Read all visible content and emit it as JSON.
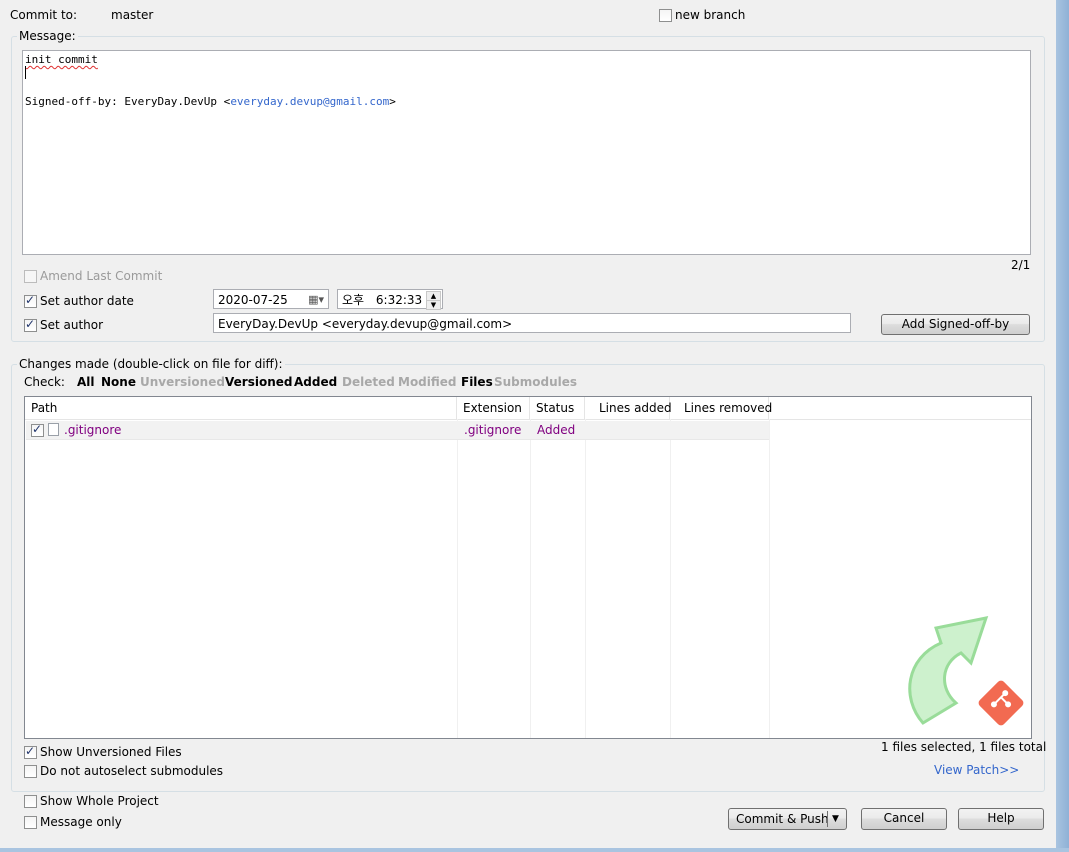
{
  "commit_to_label": "Commit to:",
  "branch": "master",
  "new_branch_label": "new branch",
  "message_group_label": "Message:",
  "message": {
    "line1": "init commit",
    "signoff_prefix": "Signed-off-by: EveryDay.DevUp <",
    "signoff_email": "everyday.devup@gmail.com",
    "signoff_suffix": ">",
    "counter": "2/1"
  },
  "amend_label": "Amend Last Commit",
  "set_author_date_label": "Set author date",
  "author_date": "2020-07-25",
  "author_time_ampm": "오후",
  "author_time": "6:32:33",
  "set_author_label": "Set author",
  "author_value": "EveryDay.DevUp <everyday.devup@gmail.com>",
  "add_signoff_button": "Add Signed-off-by",
  "changes_group_label": "Changes made (double-click on file for diff):",
  "check_label": "Check:",
  "filters": {
    "all": "All",
    "none": "None",
    "unversioned": "Unversioned",
    "versioned": "Versioned",
    "added": "Added",
    "deleted": "Deleted",
    "modified": "Modified",
    "files": "Files",
    "submodules": "Submodules"
  },
  "columns": {
    "path": "Path",
    "extension": "Extension",
    "status": "Status",
    "lines_added": "Lines added",
    "lines_removed": "Lines removed"
  },
  "files": [
    {
      "path": ".gitignore",
      "extension": ".gitignore",
      "status": "Added",
      "checked": true
    }
  ],
  "selection_summary": "1 files selected, 1 files total",
  "show_unversioned_label": "Show Unversioned Files",
  "no_autoselect_label": "Do not autoselect submodules",
  "view_patch_link": "View Patch>>",
  "show_whole_project_label": "Show Whole Project",
  "message_only_label": "Message only",
  "commit_push_button": "Commit & Push",
  "cancel_button": "Cancel",
  "help_button": "Help",
  "colors": {
    "link": "#3366cc",
    "file_text": "#800080",
    "logo_green": "#8fd98f",
    "git_orange": "#f05033"
  }
}
